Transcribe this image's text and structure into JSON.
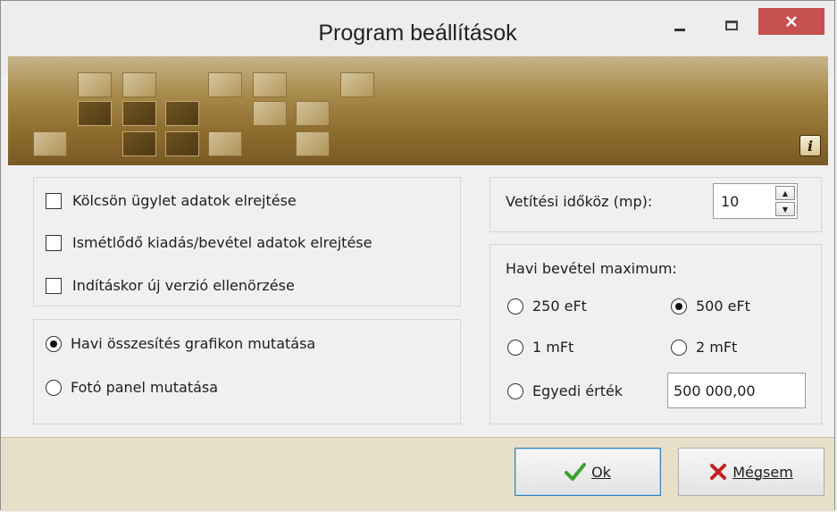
{
  "window": {
    "title": "Program beállítások",
    "minimize_label": "minimize",
    "maximize_label": "maximize",
    "close_label": "close"
  },
  "left_panel": {
    "checkboxes": [
      {
        "label": "Kölcsön ügylet adatok elrejtése",
        "checked": false
      },
      {
        "label": "Ismétlődő kiadás/bevétel adatok elrejtése",
        "checked": false
      },
      {
        "label": "Indításkor új verzió ellenörzése",
        "checked": false
      }
    ],
    "radios": [
      {
        "label": "Havi összesítés grafikon mutatása",
        "selected": true
      },
      {
        "label": "Fotó panel mutatása",
        "selected": false
      }
    ]
  },
  "right_panel": {
    "interval_label": "Vetítési időköz (mp):",
    "interval_value": "10",
    "income_max_label": "Havi bevétel maximum:",
    "options": [
      {
        "label": "250 eFt",
        "selected": false
      },
      {
        "label": "500 eFt",
        "selected": true
      },
      {
        "label": "1 mFt",
        "selected": false
      },
      {
        "label": "2 mFt",
        "selected": false
      },
      {
        "label": "Egyedi érték",
        "selected": false
      }
    ],
    "custom_value": "500 000,00"
  },
  "buttons": {
    "ok_label": "Ok",
    "cancel_label": "Mégsem"
  },
  "colors": {
    "close_button": "#c75050",
    "footer": "#e7dfc9",
    "ok_check": "#3aa12f",
    "cancel_x": "#c0221d"
  }
}
